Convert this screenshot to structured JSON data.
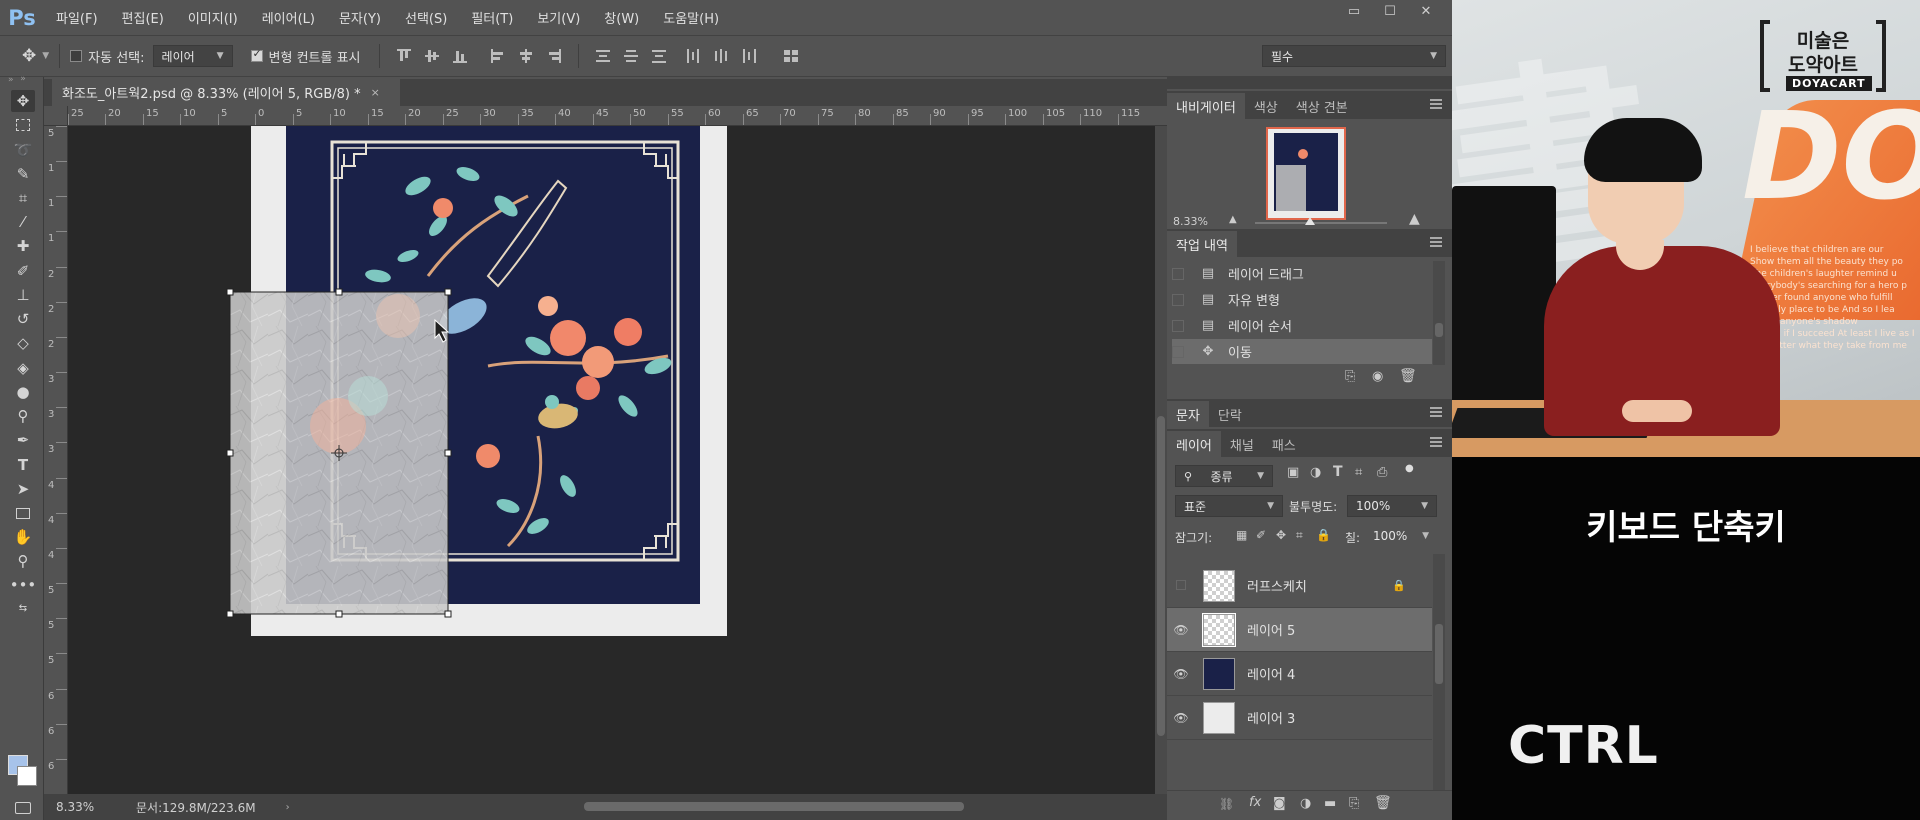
{
  "app": {
    "logo": "Ps",
    "menus": [
      "파일(F)",
      "편집(E)",
      "이미지(I)",
      "레이어(L)",
      "문자(Y)",
      "선택(S)",
      "필터(T)",
      "보기(V)",
      "창(W)",
      "도움말(H)"
    ],
    "window_controls": [
      "▭",
      "☐",
      "✕"
    ]
  },
  "options": {
    "auto_select_label": "자동 선택:",
    "auto_select_checked": false,
    "auto_select_target": "레이어",
    "show_transform_label": "변형 컨트롤 표시",
    "show_transform_checked": true,
    "workspace": "필수"
  },
  "document": {
    "tab_title": "화조도_아트웍2.psd @ 8.33% (레이어 5, RGB/8) *",
    "close_glyph": "×"
  },
  "rulers": {
    "horizontal_labels": [
      "25",
      "20",
      "15",
      "10",
      "5",
      "0",
      "5",
      "10",
      "15",
      "20",
      "25",
      "30",
      "35",
      "40",
      "45",
      "50",
      "55",
      "60",
      "65",
      "70",
      "75",
      "80",
      "85",
      "90",
      "95",
      "100",
      "105",
      "110",
      "115"
    ],
    "vertical_labels": [
      "5",
      "1",
      "1",
      "1",
      "2",
      "2",
      "2",
      "3",
      "3",
      "3",
      "4",
      "4",
      "4",
      "5",
      "5",
      "5",
      "6",
      "6",
      "6"
    ]
  },
  "status": {
    "zoom": "8.33%",
    "doc_size": "문서:129.8M/223.6M"
  },
  "navigator": {
    "tabs": [
      "내비게이터",
      "색상",
      "색상 견본"
    ],
    "zoom": "8.33%",
    "zoom_level": 0.42
  },
  "history": {
    "tab": "작업 내역",
    "items": [
      {
        "label": "레이어 드래그",
        "icon": "document-icon",
        "selected": false
      },
      {
        "label": "자유 변형",
        "icon": "document-icon",
        "selected": false
      },
      {
        "label": "레이어 순서",
        "icon": "document-icon",
        "selected": false
      },
      {
        "label": "이동",
        "icon": "move-icon",
        "selected": true
      }
    ]
  },
  "char_panel": {
    "tabs": [
      "문자",
      "단락"
    ]
  },
  "layers": {
    "tabs": [
      "레이어",
      "채널",
      "패스"
    ],
    "filter_kind": "종류",
    "blend_mode": "표준",
    "opacity_label": "불투명도:",
    "opacity": "100%",
    "lock_label": "잠그기:",
    "fill_label": "칠:",
    "fill": "100%",
    "items": [
      {
        "name": "러프스케치",
        "visible": false,
        "locked": true,
        "selected": false,
        "thumb": "checker"
      },
      {
        "name": "레이어 5",
        "visible": true,
        "locked": false,
        "selected": true,
        "thumb": "checker"
      },
      {
        "name": "레이어 4",
        "visible": true,
        "locked": false,
        "selected": false,
        "thumb": "navy"
      },
      {
        "name": "레이어 3",
        "visible": true,
        "locked": false,
        "selected": false,
        "thumb": "white"
      }
    ]
  },
  "video": {
    "brand_line1": "미술은",
    "brand_line2": "도약아트",
    "brand_tag": "DOYACART",
    "bg_text": "DO",
    "bg_lines": [
      "I believe that children are our",
      "Show them all the beauty they po",
      "The children's laughter remind u",
      "Everybody's searching for a hero p",
      "I never found anyone who fulfill",
      "A lonely place to be And so I lea",
      "Get in anyone's shadow",
      "If I fail, if I succeed At least I live as I",
      "No matter what they take from me"
    ],
    "caption": "키보드 단축키",
    "key": "CTRL"
  },
  "colors": {
    "panel_bg": "#535353",
    "canvas_bg": "#282828",
    "artwork_navy": "#1a2148",
    "foreground": "#a7c3ea",
    "background": "#ffffff"
  }
}
